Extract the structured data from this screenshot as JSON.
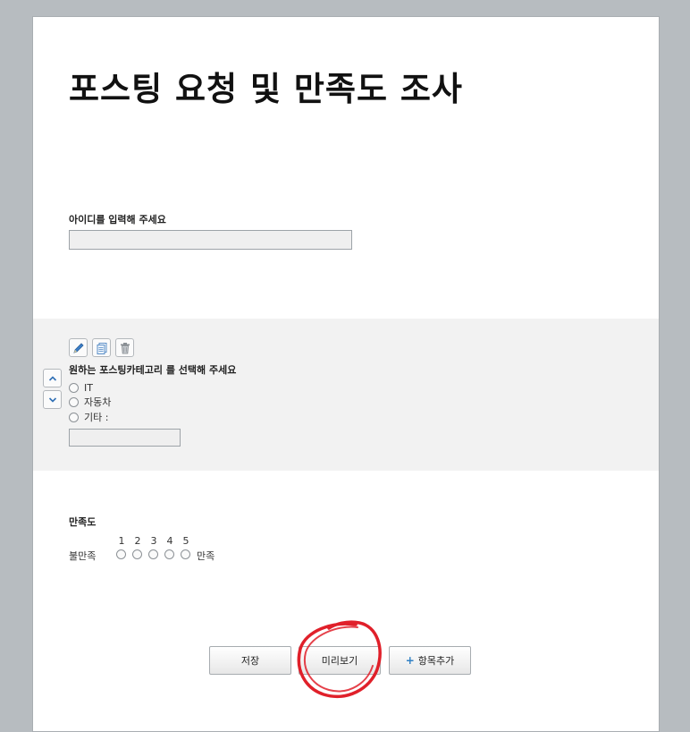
{
  "form": {
    "title": "포스팅 요청 및 만족도 조사"
  },
  "questions": {
    "q1": {
      "label": "아이디를 입력해 주세요",
      "value": ""
    },
    "q2": {
      "label": "원하는 포스팅카테고리 를 선택해 주세요",
      "options": [
        "IT",
        "자동차",
        "기타 :"
      ],
      "other_value": ""
    },
    "q3": {
      "label": "만족도",
      "scale": [
        "1",
        "2",
        "3",
        "4",
        "5"
      ],
      "low_label": "불만족",
      "high_label": "만족"
    }
  },
  "toolbar": {
    "icons": [
      "edit-icon",
      "copy-icon",
      "trash-icon",
      "chevron-up-icon",
      "chevron-down-icon"
    ]
  },
  "actions": {
    "save_label": "저장",
    "preview_label": "미리보기",
    "add_label": "항목추가",
    "add_icon": "+"
  },
  "colors": {
    "background": "#b7bcc0",
    "selected_block": "#f2f2f2",
    "annotation": "#e0202a",
    "accent": "#2f7fc4"
  }
}
